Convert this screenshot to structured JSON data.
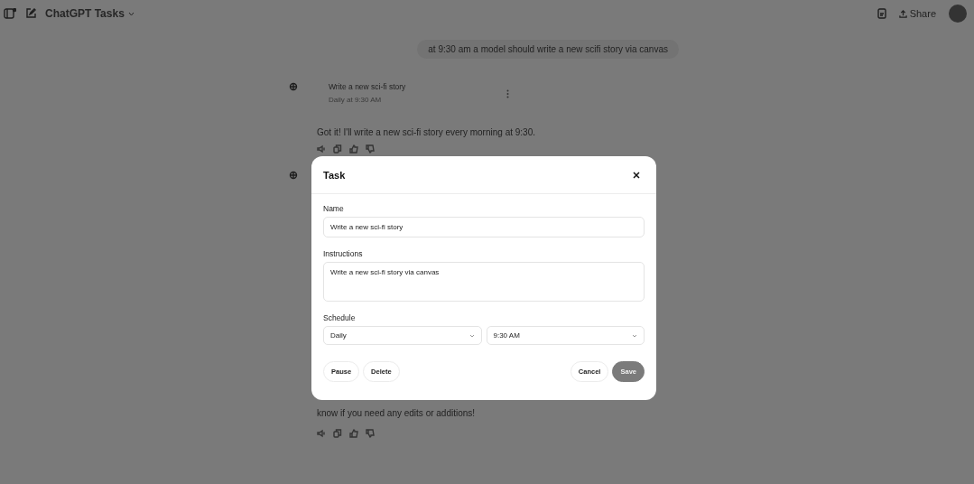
{
  "header": {
    "title": "ChatGPT Tasks",
    "share": "Share"
  },
  "conversation": {
    "user_message": "at 9:30 am a model should write a new scifi story via canvas",
    "task_card": {
      "title": "Write a new sci-fi story",
      "schedule": "Daily at 9:30 AM"
    },
    "reply": "Got it! I'll write a new sci-fi story every morning at 9:30.",
    "closing_text": "know if you need any edits or additions!"
  },
  "dialog": {
    "title": "Task",
    "fields": [
      {
        "kind": "input",
        "label": "Name",
        "value": "Write a new sci-fi story"
      },
      {
        "kind": "textarea",
        "label": "Instructions",
        "value": "Write a new sci-fi story via canvas"
      },
      {
        "kind": "selects",
        "label": "Schedule",
        "options": [
          "Daily",
          "9:30 AM"
        ]
      }
    ],
    "left_buttons": [
      {
        "label": "Pause",
        "kind": "outline"
      },
      {
        "label": "Delete",
        "kind": "outline"
      }
    ],
    "right_buttons": [
      {
        "label": "Cancel",
        "kind": "outline"
      },
      {
        "label": "Save",
        "kind": "filled"
      }
    ]
  }
}
